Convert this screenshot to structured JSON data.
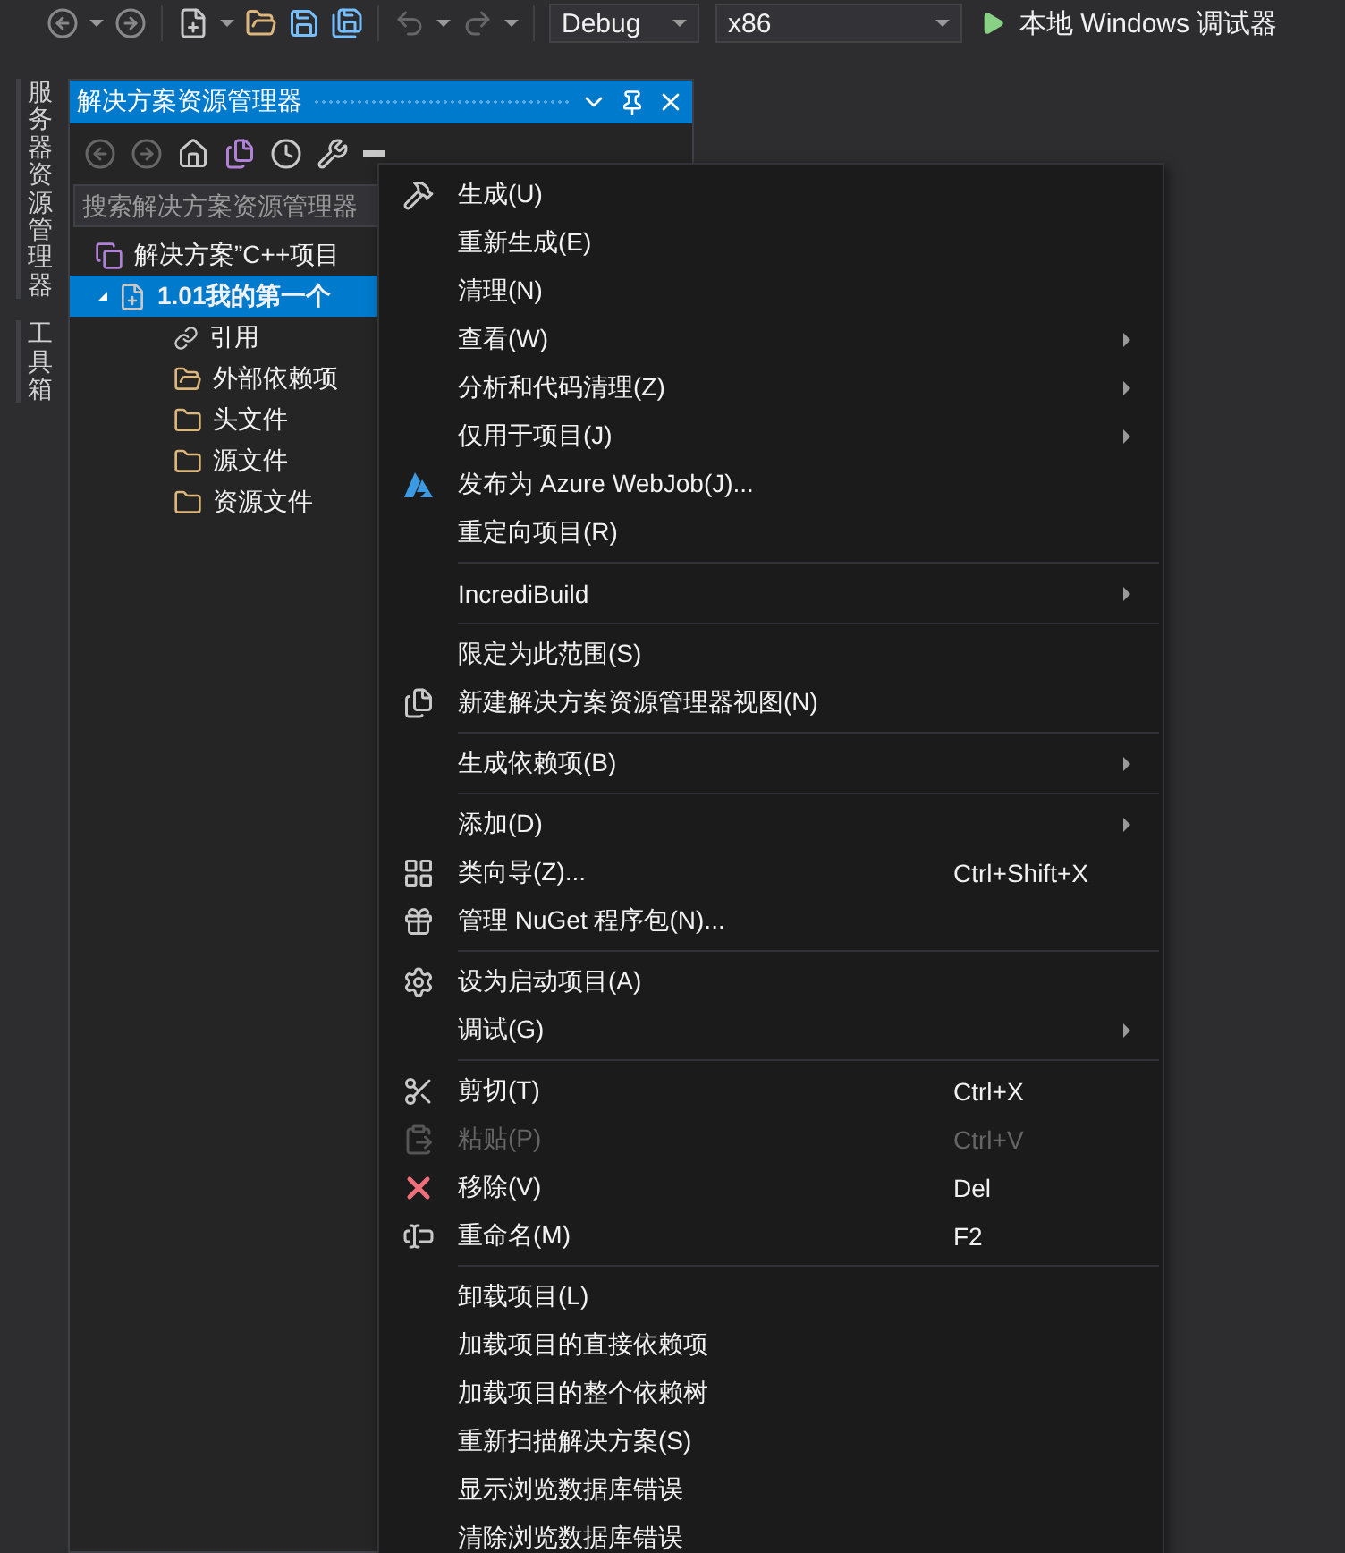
{
  "toolbar": {
    "configuration": "Debug",
    "platform": "x86",
    "run_label": "本地 Windows 调试器"
  },
  "side_tabs": [
    "服务器资源管理器",
    "工具箱"
  ],
  "solution_explorer": {
    "title": "解决方案资源管理器",
    "search": {
      "placeholder": "搜索解决方案资源管理器"
    },
    "tree": [
      {
        "label": "解决方案”C++项目",
        "selected": false,
        "children": [
          {
            "label": "1.01我的第一个",
            "expanded": true,
            "selected": true,
            "children": [
              {
                "label": "引用",
                "selected": false
              },
              {
                "label": "外部依赖项",
                "selected": false
              },
              {
                "label": "头文件",
                "selected": false
              },
              {
                "label": "源文件",
                "selected": false
              },
              {
                "label": "资源文件",
                "selected": false
              }
            ]
          }
        ]
      }
    ]
  },
  "context_menu": [
    {
      "kind": "item",
      "label": "生成(U)",
      "submenu": false,
      "disabled": false
    },
    {
      "kind": "item",
      "label": "重新生成(E)",
      "submenu": false,
      "disabled": false
    },
    {
      "kind": "item",
      "label": "清理(N)",
      "submenu": false,
      "disabled": false
    },
    {
      "kind": "item",
      "label": "查看(W)",
      "submenu": true,
      "disabled": false
    },
    {
      "kind": "item",
      "label": "分析和代码清理(Z)",
      "submenu": true,
      "disabled": false
    },
    {
      "kind": "item",
      "label": "仅用于项目(J)",
      "submenu": true,
      "disabled": false
    },
    {
      "kind": "item",
      "label": "发布为 Azure WebJob(J)...",
      "submenu": false,
      "disabled": false
    },
    {
      "kind": "item",
      "label": "重定向项目(R)",
      "submenu": false,
      "disabled": false
    },
    {
      "kind": "separator"
    },
    {
      "kind": "item",
      "label": "IncrediBuild",
      "submenu": true,
      "disabled": false
    },
    {
      "kind": "separator"
    },
    {
      "kind": "item",
      "label": "限定为此范围(S)",
      "submenu": false,
      "disabled": false
    },
    {
      "kind": "item",
      "label": "新建解决方案资源管理器视图(N)",
      "submenu": false,
      "disabled": false
    },
    {
      "kind": "separator"
    },
    {
      "kind": "item",
      "label": "生成依赖项(B)",
      "submenu": true,
      "disabled": false
    },
    {
      "kind": "separator"
    },
    {
      "kind": "item",
      "label": "添加(D)",
      "submenu": true,
      "disabled": false
    },
    {
      "kind": "item",
      "label": "类向导(Z)...",
      "shortcut": "Ctrl+Shift+X",
      "submenu": false,
      "disabled": false
    },
    {
      "kind": "item",
      "label": "管理 NuGet 程序包(N)...",
      "submenu": false,
      "disabled": false
    },
    {
      "kind": "separator"
    },
    {
      "kind": "item",
      "label": "设为启动项目(A)",
      "submenu": false,
      "disabled": false
    },
    {
      "kind": "item",
      "label": "调试(G)",
      "submenu": true,
      "disabled": false
    },
    {
      "kind": "separator"
    },
    {
      "kind": "item",
      "label": "剪切(T)",
      "shortcut": "Ctrl+X",
      "submenu": false,
      "disabled": false
    },
    {
      "kind": "item",
      "label": "粘贴(P)",
      "shortcut": "Ctrl+V",
      "submenu": false,
      "disabled": true
    },
    {
      "kind": "item",
      "label": "移除(V)",
      "shortcut": "Del",
      "submenu": false,
      "disabled": false
    },
    {
      "kind": "item",
      "label": "重命名(M)",
      "shortcut": "F2",
      "submenu": false,
      "disabled": false
    },
    {
      "kind": "separator"
    },
    {
      "kind": "item",
      "label": "卸载项目(L)",
      "submenu": false,
      "disabled": false
    },
    {
      "kind": "item",
      "label": "加载项目的直接依赖项",
      "submenu": false,
      "disabled": false
    },
    {
      "kind": "item",
      "label": "加载项目的整个依赖树",
      "submenu": false,
      "disabled": false
    },
    {
      "kind": "item",
      "label": "重新扫描解决方案(S)",
      "submenu": false,
      "disabled": false
    },
    {
      "kind": "item",
      "label": "显示浏览数据库错误",
      "submenu": false,
      "disabled": false
    },
    {
      "kind": "item",
      "label": "清除浏览数据库错误",
      "submenu": false,
      "disabled": false
    }
  ]
}
